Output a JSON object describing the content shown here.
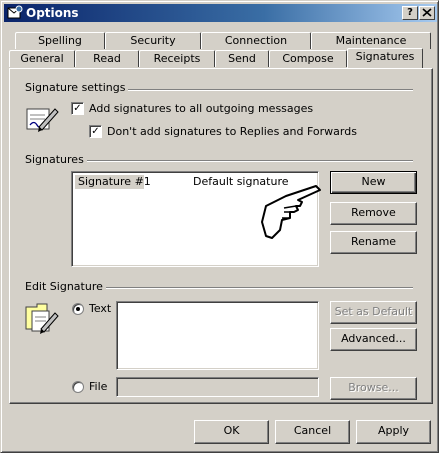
{
  "window": {
    "title": "Options",
    "help_label": "?",
    "close_label": "X"
  },
  "tabs": {
    "row1": [
      "Spelling",
      "Security",
      "Connection",
      "Maintenance"
    ],
    "row2": [
      "General",
      "Read",
      "Receipts",
      "Send",
      "Compose",
      "Signatures"
    ],
    "active": "Signatures"
  },
  "signature_settings": {
    "group_label": "Signature settings",
    "add_all_label": "Add signatures to all outgoing messages",
    "add_all_checked": true,
    "no_replies_label": "Don't add signatures to Replies and Forwards",
    "no_replies_checked": true
  },
  "signatures": {
    "group_label": "Signatures",
    "list": [
      {
        "name": "Signature #1",
        "status": "Default signature",
        "selected": true
      }
    ],
    "new_label": "New",
    "remove_label": "Remove",
    "rename_label": "Rename"
  },
  "edit_signature": {
    "group_label": "Edit Signature",
    "text_label": "Text",
    "text_value": "",
    "text_selected": true,
    "file_label": "File",
    "file_value": "",
    "set_default_label": "Set as Default",
    "advanced_label": "Advanced...",
    "browse_label": "Browse..."
  },
  "footer": {
    "ok_label": "OK",
    "cancel_label": "Cancel",
    "apply_label": "Apply"
  },
  "colors": {
    "titlebar_start": "#0a246a",
    "titlebar_end": "#a6caf0",
    "face": "#d4d0c8"
  }
}
